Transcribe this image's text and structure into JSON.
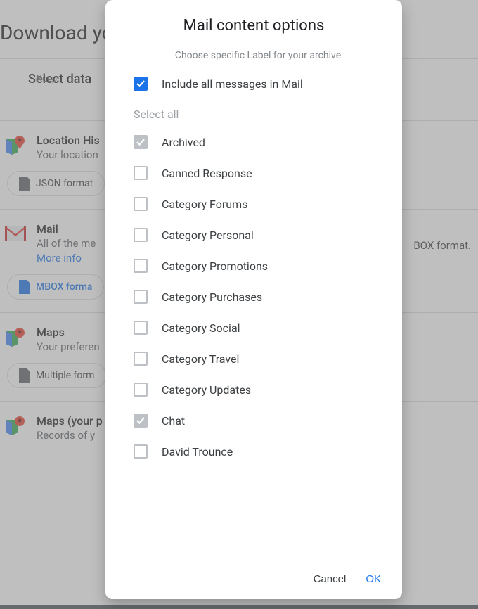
{
  "bg": {
    "page_title": "Download yo",
    "section_title": "Select data",
    "items": [
      {
        "title": "Location His",
        "desc": "Your location",
        "format": "JSON format"
      },
      {
        "title": "Mail",
        "desc": "All of the me",
        "link": "More info",
        "format": "MBOX forma",
        "right_text": "BOX format."
      },
      {
        "title": "Maps",
        "desc": "Your preferen",
        "format": "Multiple form"
      },
      {
        "title": "Maps (your p",
        "desc": "Records of y"
      }
    ],
    "keep": "Keep"
  },
  "modal": {
    "title": "Mail content options",
    "hint": "Choose specific Label for your archive",
    "include_all": "Include all messages in Mail",
    "select_all": "Select all",
    "labels": [
      {
        "name": "Archived",
        "state": "grey-checked"
      },
      {
        "name": "Canned Response",
        "state": ""
      },
      {
        "name": "Category Forums",
        "state": ""
      },
      {
        "name": "Category Personal",
        "state": ""
      },
      {
        "name": "Category Promotions",
        "state": ""
      },
      {
        "name": "Category Purchases",
        "state": ""
      },
      {
        "name": "Category Social",
        "state": ""
      },
      {
        "name": "Category Travel",
        "state": ""
      },
      {
        "name": "Category Updates",
        "state": ""
      },
      {
        "name": "Chat",
        "state": "grey-checked"
      },
      {
        "name": "David Trounce",
        "state": ""
      }
    ],
    "cancel": "Cancel",
    "ok": "OK"
  }
}
